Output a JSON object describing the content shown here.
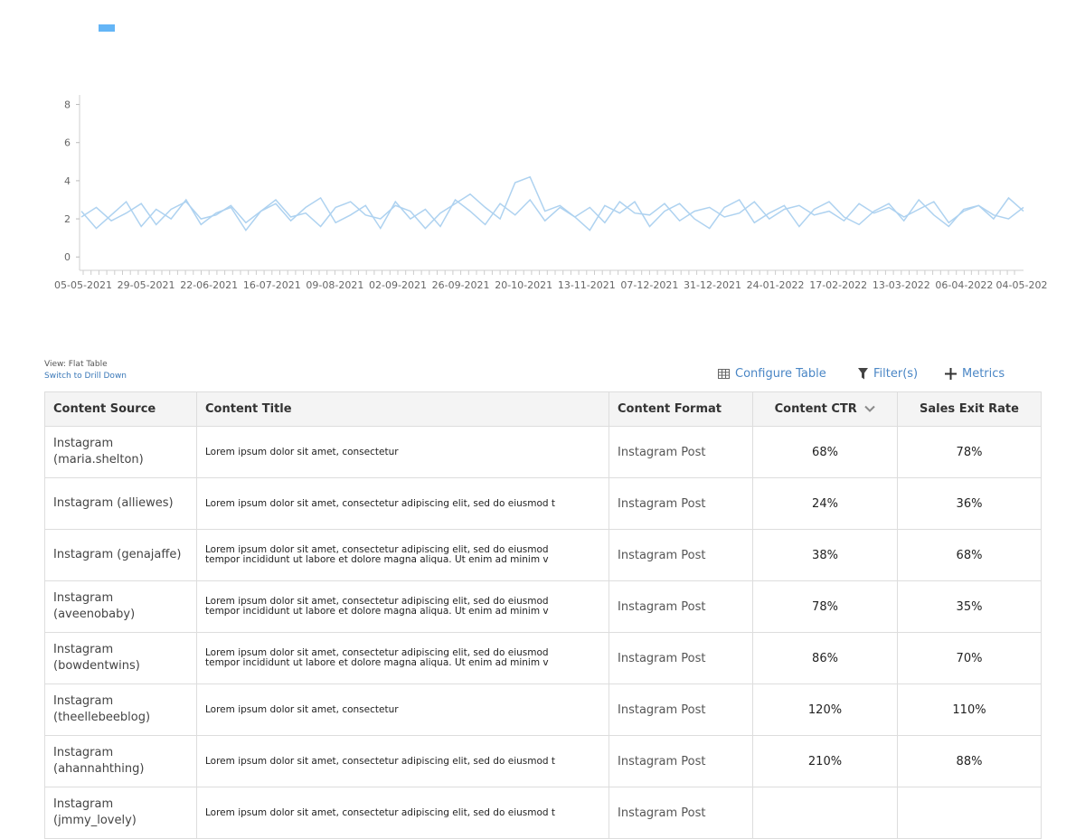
{
  "chart_data": {
    "type": "line",
    "x_tick_labels": [
      "05-05-2021",
      "29-05-2021",
      "22-06-2021",
      "16-07-2021",
      "09-08-2021",
      "02-09-2021",
      "26-09-2021",
      "20-10-2021",
      "13-11-2021",
      "07-12-2021",
      "31-12-2021",
      "24-01-2022",
      "17-02-2022",
      "13-03-2022",
      "06-04-2022",
      "04-05-202"
    ],
    "y_ticks": [
      0,
      2,
      4,
      6,
      8
    ],
    "ylim": [
      -0.7,
      8.5
    ],
    "grid": false,
    "legend_placement": "top-left",
    "series_color": "#aed2f0",
    "series": [
      {
        "values": [
          2.1,
          2.6,
          1.9,
          2.3,
          2.8,
          1.7,
          2.5,
          2.9,
          2.0,
          2.2,
          2.7,
          1.8,
          2.4,
          3.0,
          2.1,
          2.3,
          1.6,
          2.6,
          2.9,
          2.2,
          2.0,
          2.7,
          2.4,
          1.5,
          2.3,
          2.8,
          3.3,
          2.6,
          2.0,
          3.9,
          4.2,
          2.4,
          2.7,
          2.1,
          2.6,
          1.8,
          2.9,
          2.3,
          2.2,
          2.8,
          1.9,
          2.4,
          2.6,
          2.1,
          2.3,
          2.9,
          2.0,
          2.5,
          2.7,
          2.2,
          2.4,
          1.9,
          2.8,
          2.3,
          2.6,
          2.1,
          2.5,
          2.9,
          1.8,
          2.4,
          2.7,
          2.2,
          2.0,
          2.6
        ]
      },
      {
        "values": [
          2.4,
          1.5,
          2.2,
          2.9,
          1.6,
          2.5,
          2.0,
          3.0,
          1.7,
          2.3,
          2.6,
          1.4,
          2.4,
          2.8,
          1.9,
          2.6,
          3.1,
          1.8,
          2.2,
          2.7,
          1.5,
          2.9,
          2.0,
          2.5,
          1.6,
          3.0,
          2.4,
          1.7,
          2.8,
          2.2,
          3.0,
          1.9,
          2.6,
          2.1,
          1.4,
          2.7,
          2.3,
          2.9,
          1.6,
          2.4,
          2.8,
          2.0,
          1.5,
          2.6,
          3.0,
          1.8,
          2.3,
          2.7,
          1.6,
          2.5,
          2.9,
          2.1,
          1.7,
          2.4,
          2.8,
          1.9,
          3.0,
          2.2,
          1.6,
          2.5,
          2.7,
          2.0,
          3.1,
          2.4
        ]
      }
    ]
  },
  "view": {
    "label": "View: Flat Table",
    "switch_link": "Switch to Drill Down"
  },
  "toolbar": {
    "configure": "Configure Table",
    "filters": "Filter(s)",
    "metrics": "Metrics"
  },
  "table": {
    "headers": {
      "source": "Content Source",
      "title": "Content Title",
      "format": "Content Format",
      "ctr": "Content CTR",
      "exit": "Sales Exit Rate"
    },
    "rows": [
      {
        "source": "Instagram (maria.shelton)",
        "title1": "Lorem ipsum dolor sit amet, consectetur",
        "title2": "",
        "format": "Instagram Post",
        "ctr": "68%",
        "exit": "78%"
      },
      {
        "source": "Instagram (alliewes)",
        "title1": "Lorem ipsum dolor sit amet, consectetur adipiscing elit, sed do eiusmod t",
        "title2": "",
        "format": "Instagram Post",
        "ctr": "24%",
        "exit": "36%"
      },
      {
        "source": "Instagram (genajaffe)",
        "title1": "Lorem ipsum dolor sit amet, consectetur adipiscing elit, sed do eiusmod",
        "title2": "tempor incididunt ut labore et dolore magna aliqua. Ut enim ad minim v",
        "format": "Instagram Post",
        "ctr": "38%",
        "exit": "68%"
      },
      {
        "source": "Instagram (aveenobaby)",
        "title1": "Lorem ipsum dolor sit amet, consectetur adipiscing elit, sed do eiusmod",
        "title2": "tempor incididunt ut labore et dolore magna aliqua. Ut enim ad minim v",
        "format": "Instagram Post",
        "ctr": "78%",
        "exit": "35%"
      },
      {
        "source": "Instagram (bowdentwins)",
        "title1": "Lorem ipsum dolor sit amet, consectetur adipiscing elit, sed do eiusmod",
        "title2": "tempor incididunt ut labore et dolore magna aliqua. Ut enim ad minim v",
        "format": "Instagram Post",
        "ctr": "86%",
        "exit": "70%"
      },
      {
        "source": "Instagram (theellebeeblog)",
        "title1": "Lorem ipsum dolor sit amet, consectetur",
        "title2": "",
        "format": "Instagram Post",
        "ctr": "120%",
        "exit": "110%"
      },
      {
        "source": "Instagram (ahannahthing)",
        "title1": "Lorem ipsum dolor sit amet, consectetur adipiscing elit, sed do eiusmod t",
        "title2": "",
        "format": "Instagram Post",
        "ctr": "210%",
        "exit": "88%"
      },
      {
        "source": "Instagram (jmmy_lovely)",
        "title1": "Lorem ipsum dolor sit amet, consectetur adipiscing elit, sed do eiusmod t",
        "title2": "",
        "format": "Instagram Post",
        "ctr": "",
        "exit": ""
      }
    ]
  }
}
